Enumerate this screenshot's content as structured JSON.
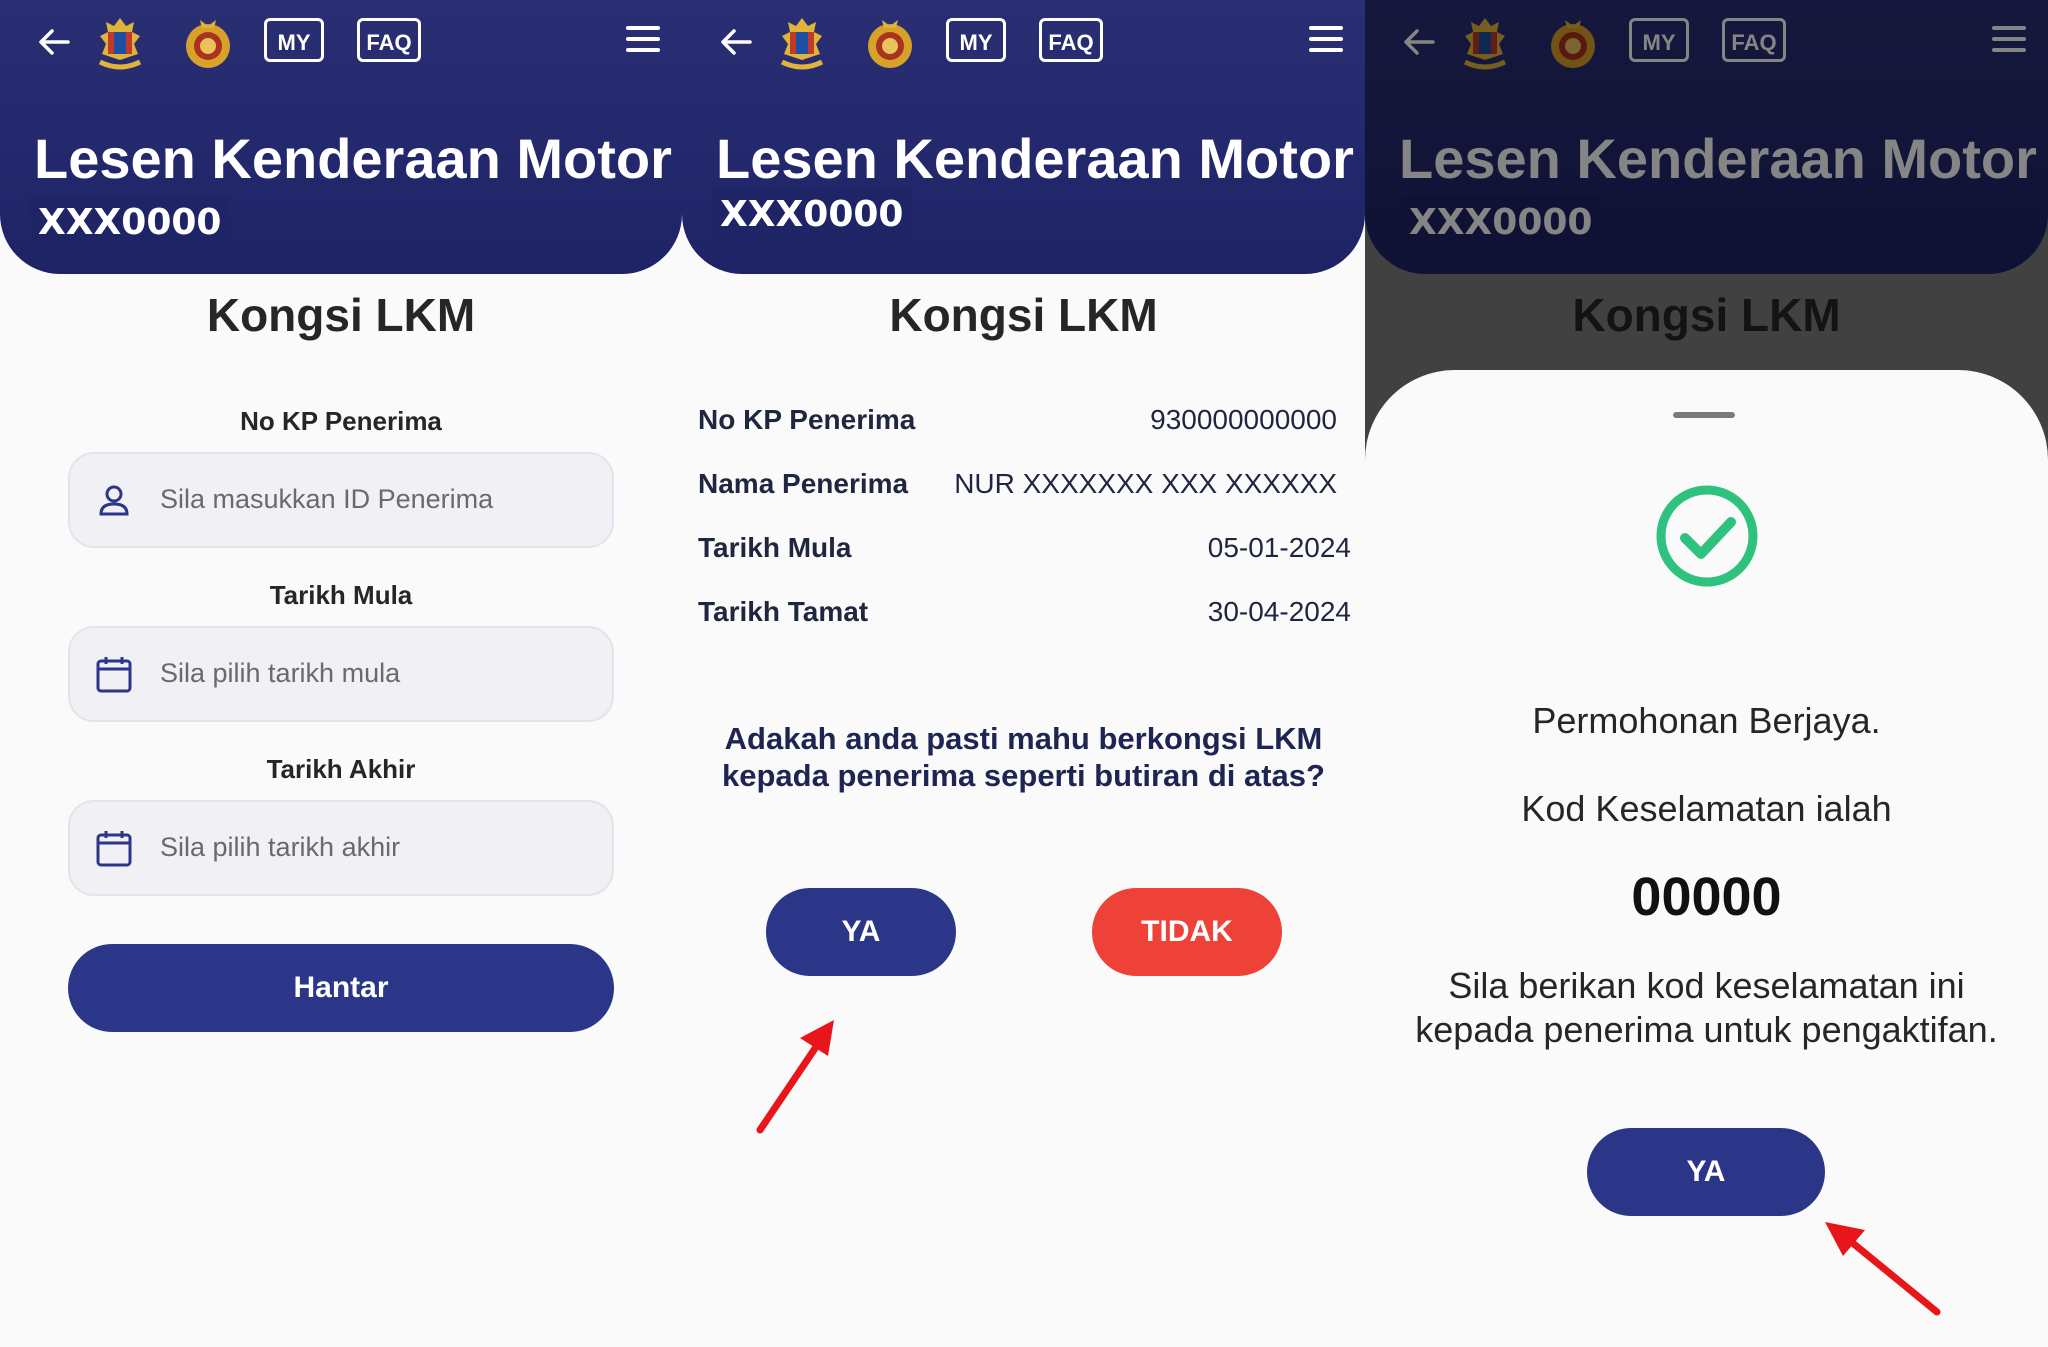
{
  "header": {
    "back_icon": "arrow-left-icon",
    "crest1_icon": "malaysia-coat-of-arms-icon",
    "crest2_icon": "jpj-emblem-icon",
    "my_label": "MY",
    "faq_label": "FAQ",
    "menu_icon": "hamburger-menu-icon",
    "title": "Lesen Kenderaan Motor",
    "plate": "XXX0000"
  },
  "page_title": "Kongsi LKM",
  "form": {
    "recipient_label": "No KP Penerima",
    "recipient_placeholder": "Sila masukkan ID Penerima",
    "start_label": "Tarikh Mula",
    "start_placeholder": "Sila pilih tarikh mula",
    "end_label": "Tarikh Akhir",
    "end_placeholder": "Sila pilih tarikh akhir",
    "submit": "Hantar"
  },
  "confirm": {
    "rows": [
      {
        "label": "No KP Penerima",
        "value": "930000000000"
      },
      {
        "label": "Nama Penerima",
        "value": "NUR XXXXXXX XXX XXXXXX"
      },
      {
        "label": "Tarikh Mula",
        "value": "05-01-2024"
      },
      {
        "label": "Tarikh Tamat",
        "value": "30-04-2024"
      }
    ],
    "question_line1": "Adakah anda pasti mahu berkongsi LKM",
    "question_line2": "kepada penerima seperti butiran di atas?",
    "yes": "YA",
    "no": "TIDAK"
  },
  "success": {
    "line1": "Permohonan Berjaya.",
    "line2": "Kod Keselamatan ialah",
    "code": "00000",
    "line3": "Sila berikan kod keselamatan ini",
    "line4": "kepada penerima untuk pengaktifan.",
    "ok": "YA"
  },
  "colors": {
    "header": "#2a2f74",
    "primary_button": "#2b3689",
    "danger_button": "#ee4238",
    "success_check": "#2ec27e",
    "annotation_arrow": "#e8151b"
  }
}
